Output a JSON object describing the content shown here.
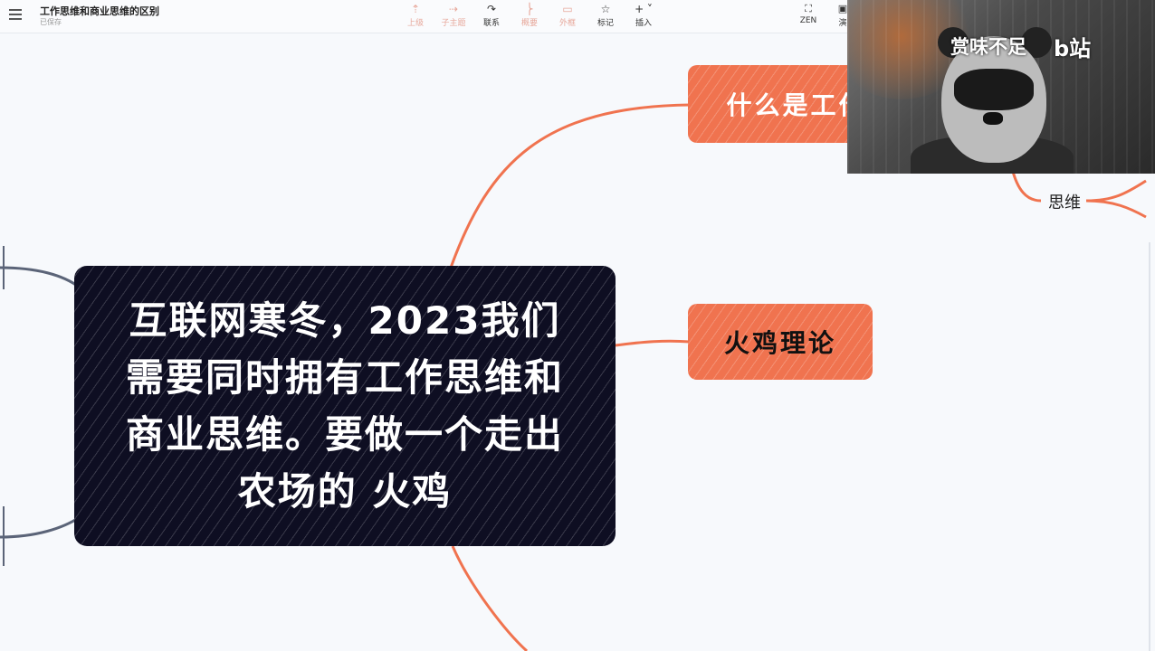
{
  "header": {
    "doc_title": "工作思维和商业思维的区别",
    "doc_subtitle": "已保存",
    "tools": [
      {
        "label": "上级",
        "icon": "arrow-up-icon"
      },
      {
        "label": "子主题",
        "icon": "branch-icon"
      },
      {
        "label": "联系",
        "icon": "link-curve-icon"
      },
      {
        "label": "概要",
        "icon": "summary-icon"
      },
      {
        "label": "外框",
        "icon": "boundary-icon"
      },
      {
        "label": "标记",
        "icon": "star-icon"
      },
      {
        "label": "插入",
        "icon": "plus-icon"
      }
    ],
    "zen_label": "ZEN",
    "right_label": "演"
  },
  "mindmap": {
    "central_topic": "互联网寒冬，2023我们需要同时拥有工作思维和商业思维。要做一个走出农场的 火鸡",
    "node_what": "什么是工作",
    "node_turkey": "火鸡理论",
    "node_thinking": "思维"
  },
  "webcam": {
    "overlay_text": "赏味不足",
    "logo_text": "b站"
  },
  "colors": {
    "branch_orange": "#f0734f",
    "central_dark": "#0e0e22",
    "branch_gray": "#5b6478",
    "background": "#f7f9fc"
  }
}
